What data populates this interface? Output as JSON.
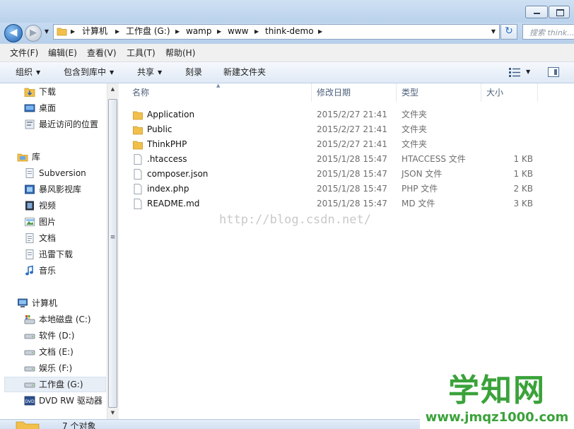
{
  "address": {
    "crumbs": [
      "计算机",
      "工作盘 (G:)",
      "wamp",
      "www",
      "think-demo"
    ]
  },
  "search": {
    "placeholder": "搜索 think..."
  },
  "menu": [
    "文件(F)",
    "编辑(E)",
    "查看(V)",
    "工具(T)",
    "帮助(H)"
  ],
  "toolbar": {
    "organize": "组织",
    "include_library": "包含到库中",
    "share": "共享",
    "burn": "刻录",
    "new_folder": "新建文件夹"
  },
  "nav": {
    "favorites": [
      "下载",
      "桌面",
      "最近访问的位置"
    ],
    "library_header": "库",
    "libraries": [
      "Subversion",
      "暴风影视库",
      "视频",
      "图片",
      "文档",
      "迅雷下载",
      "音乐"
    ],
    "computer_header": "计算机",
    "drives": [
      "本地磁盘 (C:)",
      "软件 (D:)",
      "文档 (E:)",
      "娱乐 (F:)",
      "工作盘 (G:)",
      "DVD RW 驱动器"
    ]
  },
  "columns": {
    "name": "名称",
    "date": "修改日期",
    "type": "类型",
    "size": "大小"
  },
  "files": [
    {
      "name": "Application",
      "date": "2015/2/27 21:41",
      "type": "文件夹",
      "size": "",
      "icon": "folder-icon"
    },
    {
      "name": "Public",
      "date": "2015/2/27 21:41",
      "type": "文件夹",
      "size": "",
      "icon": "folder-icon"
    },
    {
      "name": "ThinkPHP",
      "date": "2015/2/27 21:41",
      "type": "文件夹",
      "size": "",
      "icon": "folder-icon"
    },
    {
      "name": ".htaccess",
      "date": "2015/1/28 15:47",
      "type": "HTACCESS 文件",
      "size": "1 KB",
      "icon": "file-icon"
    },
    {
      "name": "composer.json",
      "date": "2015/1/28 15:47",
      "type": "JSON 文件",
      "size": "1 KB",
      "icon": "file-icon"
    },
    {
      "name": "index.php",
      "date": "2015/1/28 15:47",
      "type": "PHP 文件",
      "size": "2 KB",
      "icon": "file-icon"
    },
    {
      "name": "README.md",
      "date": "2015/1/28 15:47",
      "type": "MD 文件",
      "size": "3 KB",
      "icon": "file-icon"
    }
  ],
  "watermark": "http://blog.csdn.net/",
  "status": {
    "text": "7 个对象"
  },
  "logo": {
    "main": "学知网",
    "sub": "www.jmqz1000.com"
  },
  "colors": {
    "accent": "#1f62b0",
    "logo_green": "#3aa23a",
    "folder": "#f2c04a"
  }
}
